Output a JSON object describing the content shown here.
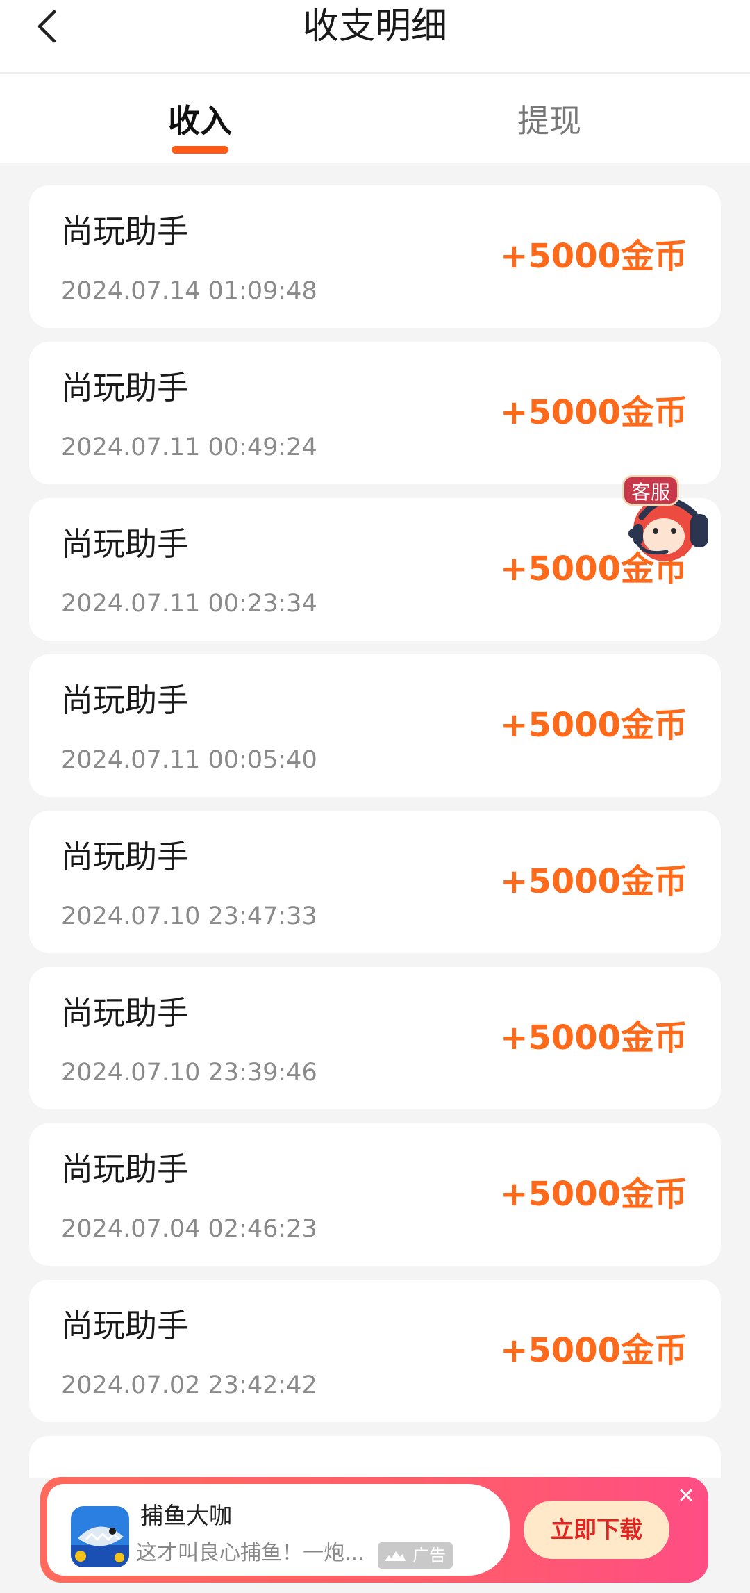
{
  "header": {
    "title": "收支明细"
  },
  "tabs": [
    {
      "label": "收入",
      "active": true
    },
    {
      "label": "提现",
      "active": false
    }
  ],
  "records": [
    {
      "name": "尚玩助手",
      "time": "2024.07.14 01:09:48",
      "amount": "+5000金币"
    },
    {
      "name": "尚玩助手",
      "time": "2024.07.11 00:49:24",
      "amount": "+5000金币"
    },
    {
      "name": "尚玩助手",
      "time": "2024.07.11 00:23:34",
      "amount": "+5000金币"
    },
    {
      "name": "尚玩助手",
      "time": "2024.07.11 00:05:40",
      "amount": "+5000金币"
    },
    {
      "name": "尚玩助手",
      "time": "2024.07.10 23:47:33",
      "amount": "+5000金币"
    },
    {
      "name": "尚玩助手",
      "time": "2024.07.10 23:39:46",
      "amount": "+5000金币"
    },
    {
      "name": "尚玩助手",
      "time": "2024.07.04 02:46:23",
      "amount": "+5000金币"
    },
    {
      "name": "尚玩助手",
      "time": "2024.07.02 23:42:42",
      "amount": "+5000金币"
    }
  ],
  "customer_service": {
    "badge": "客服"
  },
  "ad": {
    "title": "捕鱼大咖",
    "description": "这才叫良心捕鱼！一炮...",
    "tag": "广告",
    "cta": "立即下载"
  },
  "colors": {
    "accent": "#ff5a14",
    "amount": "#ff6a1a"
  }
}
